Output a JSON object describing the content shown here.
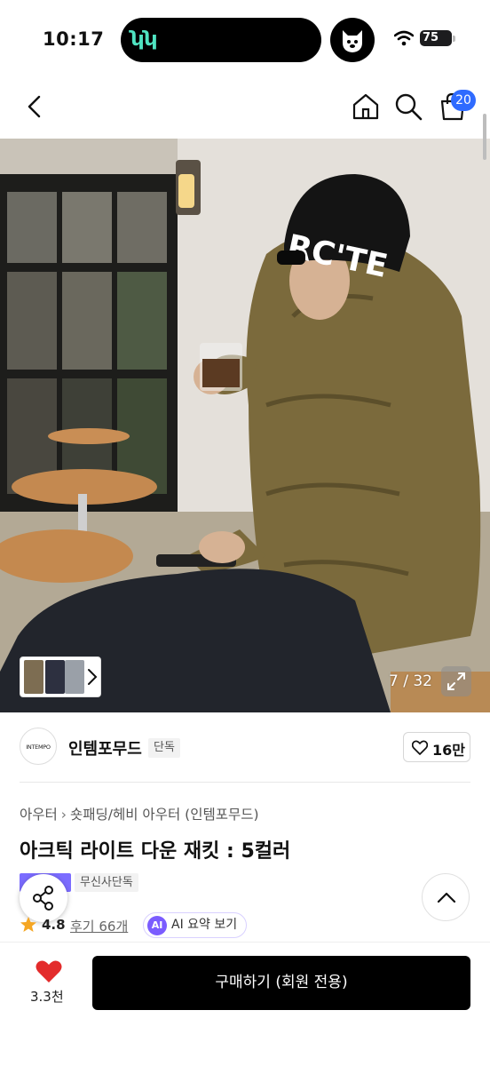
{
  "status_bar": {
    "time": "10:17",
    "battery": "75",
    "app_glyph": "ʮʮ"
  },
  "nav": {
    "cart_count": "20"
  },
  "gallery": {
    "counter": "7 / 32"
  },
  "brand": {
    "logo_text": "INTEMPO",
    "name": "인템포무드",
    "tag": "단독",
    "likes": "16만"
  },
  "product": {
    "breadcrumb": [
      "아우터",
      "숏패딩/헤비 아우터 (인템포무드)"
    ],
    "title": "아크틱 라이트 다운 재킷 : 5컬러",
    "badge_exclusive": "무신사단독",
    "rating": "4.8",
    "reviews": "후기 66개",
    "ai_icon": "AI",
    "ai_summary": "AI 요약 보기"
  },
  "bottom_bar": {
    "wish_count": "3.3천",
    "buy_label": "구매하기 (회원 전용)"
  },
  "colors": {
    "cart_badge": "#2f6bff",
    "heart_red": "#e32b2b",
    "buy_button": "#000000",
    "star": "#f5a623",
    "ai_purple": "#7b5cff"
  }
}
